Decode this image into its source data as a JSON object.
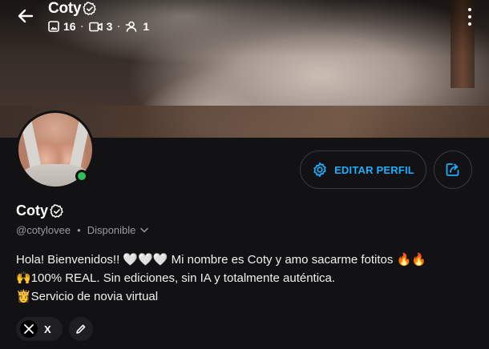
{
  "header": {
    "title": "Coty",
    "stats": {
      "photos": "16",
      "videos": "3",
      "subscribers": "1"
    }
  },
  "profile": {
    "name": "Coty",
    "handle": "@cotylovee",
    "separator": "•",
    "status": "Disponible",
    "online": true
  },
  "actions": {
    "edit_label": "EDITAR PERFIL"
  },
  "bio": {
    "line1": "Hola! Bienvenidos!! 🤍🤍🤍 Mi nombre es Coty y amo sacarme fotitos 🔥🔥",
    "line2": "🙌100% REAL. Sin ediciones, sin IA y totalmente auténtica.",
    "line3": "👸Servicio de novia virtual"
  },
  "socials": {
    "x_label": "X"
  },
  "colors": {
    "background": "#121214",
    "accent": "#20aefc",
    "online": "#2ec05a",
    "muted_text": "#9a9aa0"
  },
  "icons": {
    "back": "arrow-left-icon",
    "verified": "verified-badge-icon",
    "photos": "image-icon",
    "videos": "video-icon",
    "subscribers": "person-icon",
    "more": "more-vertical-icon",
    "edit": "gear-icon",
    "share": "share-icon",
    "x": "x-logo-icon",
    "pencil": "pencil-icon"
  }
}
